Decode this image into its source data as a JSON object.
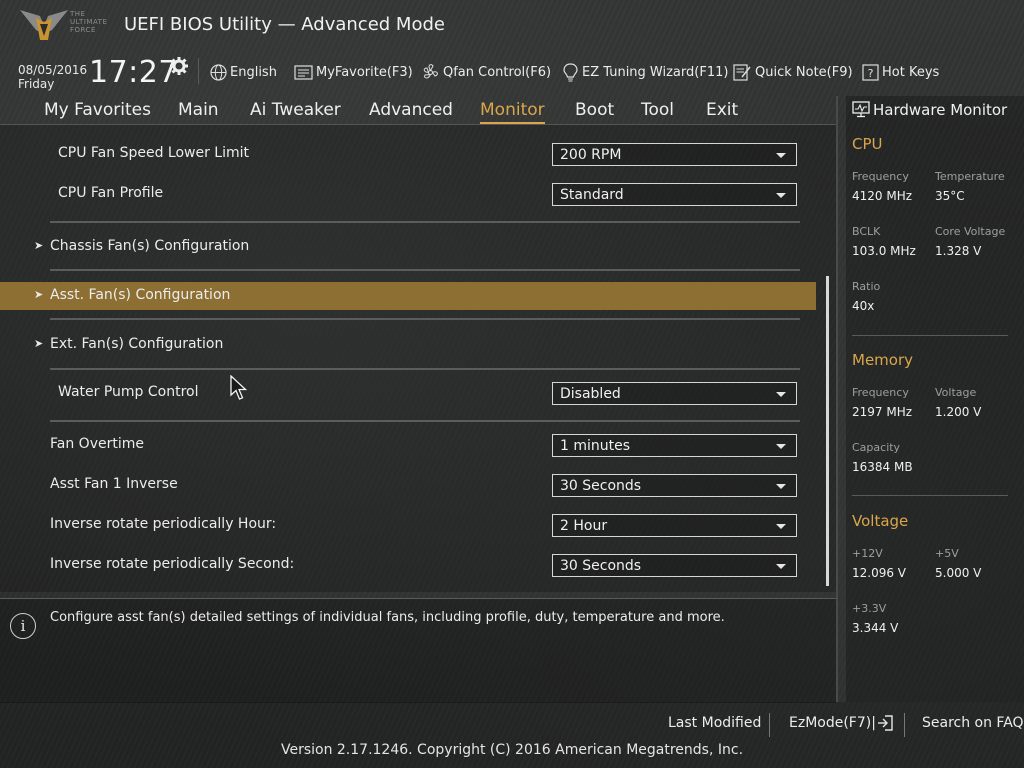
{
  "brand": {
    "logo_text": [
      "THE",
      "ULTIMATE",
      "FORCE"
    ],
    "title": "UEFI BIOS Utility — Advanced Mode"
  },
  "status": {
    "date": "08/05/2016",
    "day": "Friday",
    "time": "17:27"
  },
  "toolbar": {
    "language": "English",
    "myfavorite": "MyFavorite(F3)",
    "qfan": "Qfan Control(F6)",
    "ez_tuning": "EZ Tuning Wizard(F11)",
    "quick_note": "Quick Note(F9)",
    "hot_keys": "Hot Keys"
  },
  "tabs": [
    "My Favorites",
    "Main",
    "Ai Tweaker",
    "Advanced",
    "Monitor",
    "Boot",
    "Tool",
    "Exit"
  ],
  "active_tab": "Monitor",
  "settings": {
    "cpu_fan_lower": {
      "label": "CPU Fan Speed Lower Limit",
      "value": "200 RPM"
    },
    "cpu_fan_profile": {
      "label": "CPU Fan Profile",
      "value": "Standard"
    },
    "chassis_fans": {
      "label": "Chassis Fan(s) Configuration"
    },
    "asst_fans": {
      "label": "Asst. Fan(s) Configuration"
    },
    "ext_fans": {
      "label": "Ext. Fan(s) Configuration"
    },
    "water_pump": {
      "label": "Water Pump Control",
      "value": "Disabled"
    },
    "fan_overtime": {
      "label": "Fan Overtime",
      "value": "1 minutes"
    },
    "asst_fan1_inverse": {
      "label": "Asst Fan 1 Inverse",
      "value": "30 Seconds"
    },
    "inverse_hour": {
      "label": "Inverse rotate periodically Hour:",
      "value": "2 Hour"
    },
    "inverse_second": {
      "label": "Inverse rotate periodically Second:",
      "value": "30 Seconds"
    }
  },
  "help_text": "Configure asst fan(s) detailed settings of individual fans, including profile, duty, temperature and more.",
  "hw_monitor": {
    "title": "Hardware Monitor",
    "cpu": {
      "heading": "CPU",
      "frequency_label": "Frequency",
      "frequency": "4120 MHz",
      "temperature_label": "Temperature",
      "temperature": "35°C",
      "bclk_label": "BCLK",
      "bclk": "103.0 MHz",
      "core_voltage_label": "Core Voltage",
      "core_voltage": "1.328 V",
      "ratio_label": "Ratio",
      "ratio": "40x"
    },
    "memory": {
      "heading": "Memory",
      "frequency_label": "Frequency",
      "frequency": "2197 MHz",
      "voltage_label": "Voltage",
      "voltage": "1.200 V",
      "capacity_label": "Capacity",
      "capacity": "16384 MB"
    },
    "voltage": {
      "heading": "Voltage",
      "v12_label": "+12V",
      "v12": "12.096 V",
      "v5_label": "+5V",
      "v5": "5.000 V",
      "v33_label": "+3.3V",
      "v33": "3.344 V"
    }
  },
  "footer": {
    "last_modified": "Last Modified",
    "ezmode": "EzMode(F7)|",
    "search_faq": "Search on FAQ",
    "copyright": "Version 2.17.1246. Copyright (C) 2016 American Megatrends, Inc."
  },
  "colors": {
    "accent": "#d9a64b",
    "highlight_row": "#8d6f34"
  }
}
